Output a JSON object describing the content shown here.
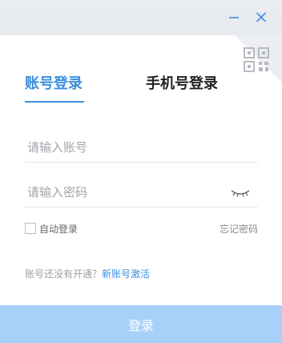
{
  "window": {
    "minimize_icon": "minimize-icon",
    "close_icon": "close-icon",
    "titlebar_color": "#e8ebef"
  },
  "qr_toggle": {
    "icon": "qr-code-icon"
  },
  "tabs": [
    {
      "label": "账号登录",
      "active": true
    },
    {
      "label": "手机号登录",
      "active": false
    }
  ],
  "form": {
    "account_placeholder": "请输入账号",
    "account_value": "",
    "password_placeholder": "请输入密码",
    "password_value": "",
    "eye_icon": "eye-closed-icon"
  },
  "options": {
    "auto_login_label": "自动登录",
    "auto_login_checked": false,
    "forgot_password": "忘记密码"
  },
  "register": {
    "text": "账号还没有开通？",
    "link": "新账号激活"
  },
  "submit": {
    "label": "登录"
  },
  "colors": {
    "accent": "#3b8fe0",
    "button_disabled": "#a8d1fa"
  }
}
